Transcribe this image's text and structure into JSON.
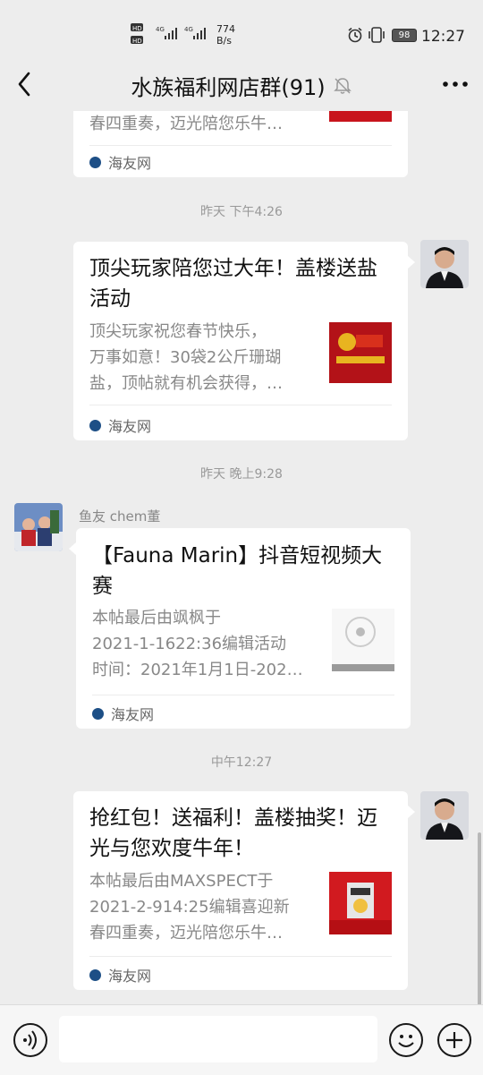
{
  "status_bar": {
    "network_speed_value": "774",
    "network_speed_unit": "B/s",
    "battery": "98",
    "time": "12:27"
  },
  "header": {
    "title": "水族福利网店群(91)"
  },
  "messages": [
    {
      "desc_lines": [
        "春四重奏，迈光陪您乐牛…"
      ],
      "source": "海友网"
    },
    {
      "timestamp": "昨天 下午4:26",
      "title": "顶尖玩家陪您过大年！盖楼送盐活动",
      "desc_lines": [
        "顶尖玩家祝您春节快乐，",
        "万事如意！30袋2公斤珊瑚",
        "盐，顶帖就有机会获得，…"
      ],
      "source": "海友网"
    },
    {
      "timestamp": "昨天 晚上9:28",
      "sender": "鱼友 chem董",
      "title": "【Fauna Marin】抖音短视频大赛",
      "desc_lines": [
        "本帖最后由飒枫于",
        "2021-1-1622:36编辑活动",
        "时间：2021年1月1日-202…"
      ],
      "source": "海友网"
    },
    {
      "timestamp": "中午12:27",
      "title": "抢红包！送福利！盖楼抽奖！迈光与您欢度牛年！",
      "desc_lines": [
        "本帖最后由MAXSPECT于",
        "2021-2-914:25编辑喜迎新",
        "春四重奏，迈光陪您乐牛…"
      ],
      "source": "海友网"
    }
  ],
  "colors": {
    "background": "#ededed",
    "bubble": "#ffffff",
    "source_dot": "#1d4f86"
  },
  "icons": [
    "back-arrow-icon",
    "mute-bell-icon",
    "more-icon",
    "voice-icon",
    "emoji-icon",
    "plus-icon"
  ]
}
